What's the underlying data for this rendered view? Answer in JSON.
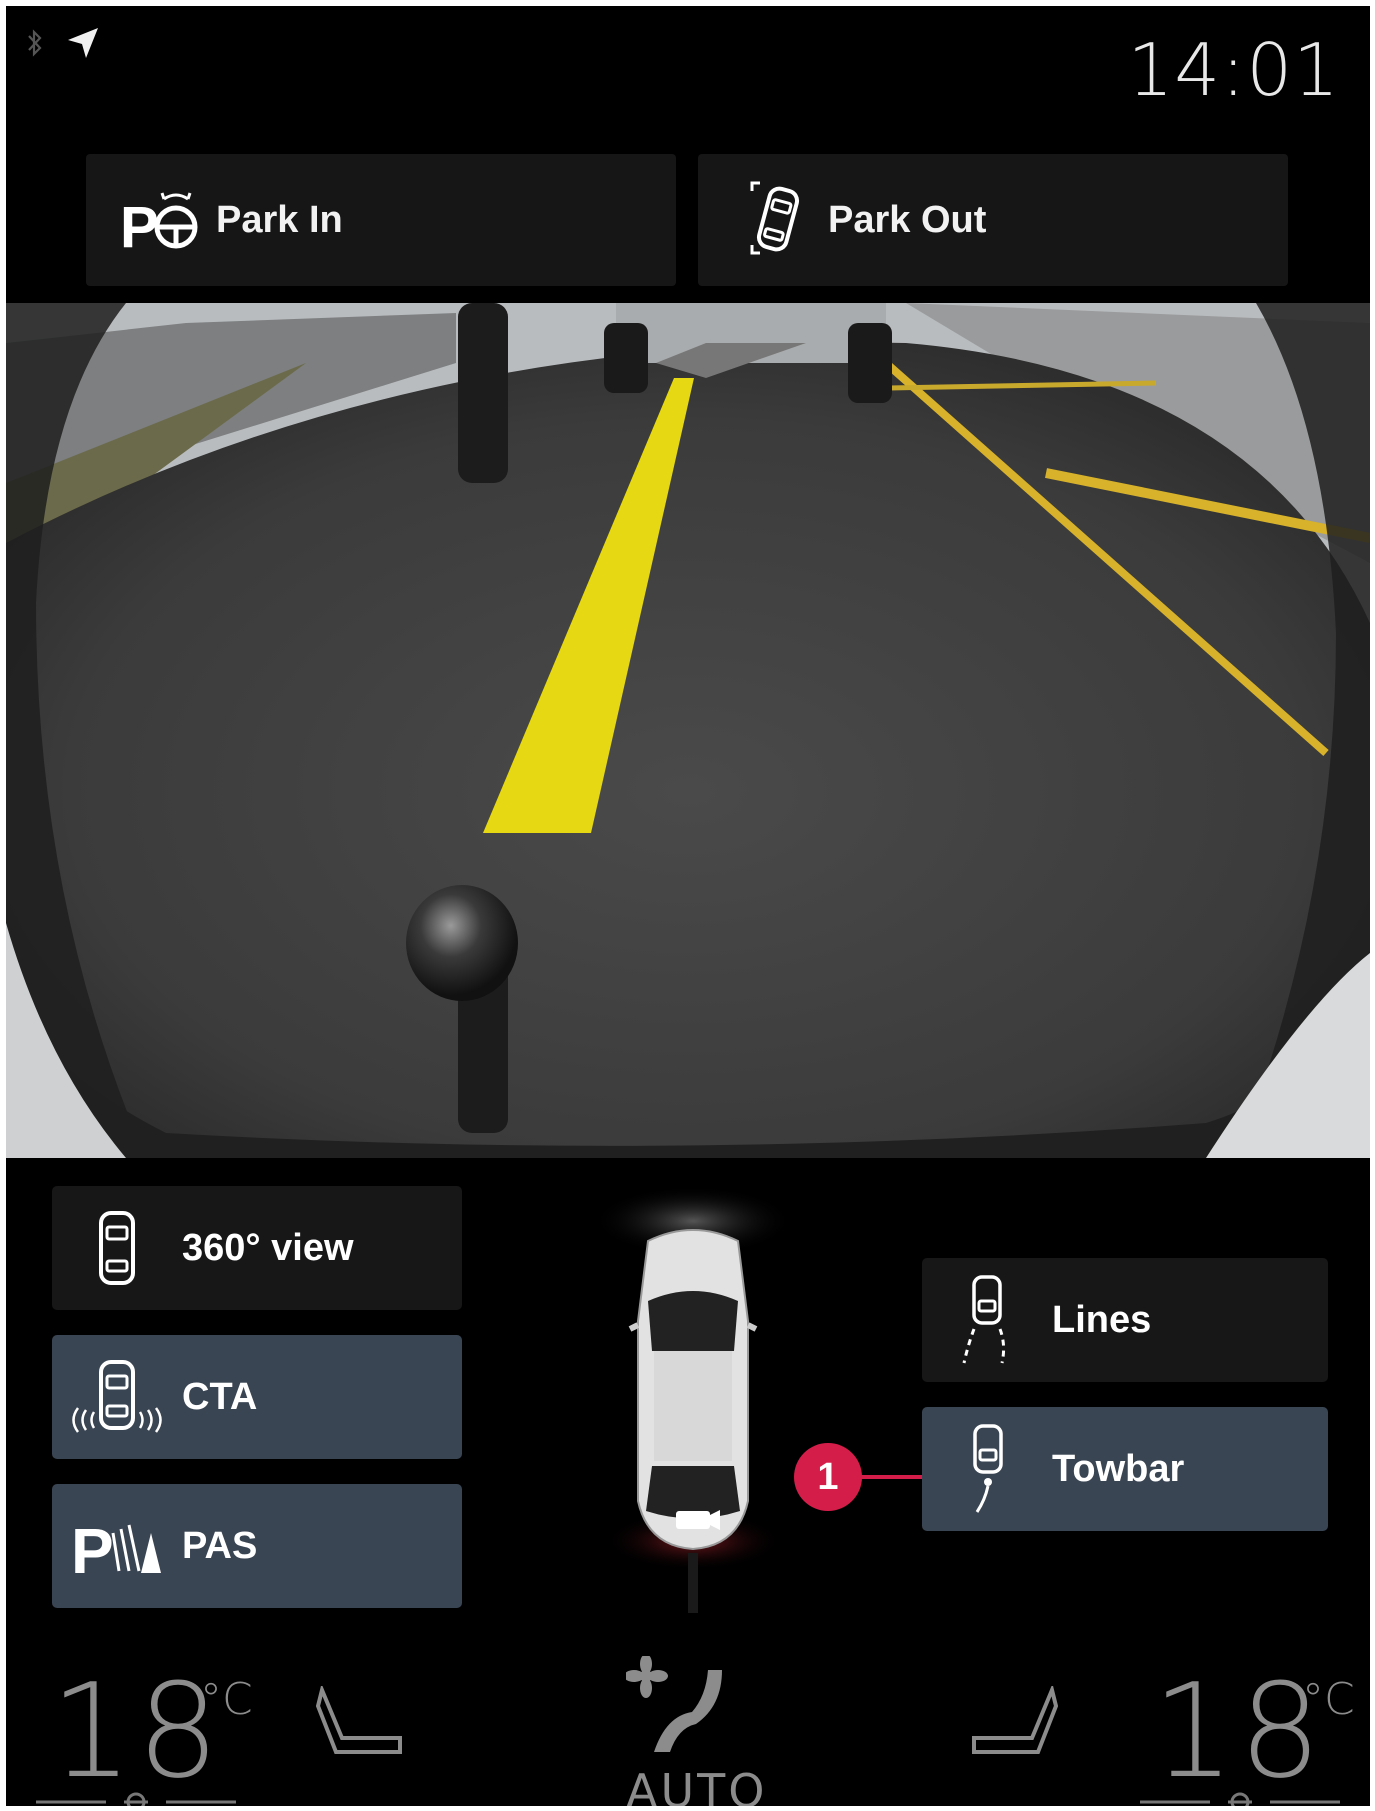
{
  "status": {
    "time": "14:01",
    "icons": [
      "bluetooth-icon",
      "navigation-arrow-icon"
    ]
  },
  "top_buttons": [
    {
      "label": "Park In",
      "icon": "park-in-steering-icon"
    },
    {
      "label": "Park Out",
      "icon": "park-out-car-icon"
    }
  ],
  "camera": {
    "view": "rear camera",
    "guide_line_color": "#e6d812"
  },
  "left_buttons": [
    {
      "label": "360° view",
      "icon": "car-360-icon",
      "active": false
    },
    {
      "label": "CTA",
      "icon": "cta-car-waves-icon",
      "active": true
    },
    {
      "label": "PAS",
      "icon": "pas-sensor-icon",
      "active": true
    }
  ],
  "right_buttons": [
    {
      "label": "Lines",
      "icon": "lines-car-icon",
      "active": false
    },
    {
      "label": "Towbar",
      "icon": "towbar-car-icon",
      "active": true
    }
  ],
  "callout": {
    "number": "1",
    "color": "#d51d4a"
  },
  "climate": {
    "left_temp": "18",
    "left_unit": "°C",
    "right_temp": "18",
    "right_unit": "°C",
    "fan_label": "AUTO"
  },
  "colors": {
    "background": "#000000",
    "button_dark": "#171717",
    "button_active": "#3a4553",
    "text": "#ffffff"
  }
}
